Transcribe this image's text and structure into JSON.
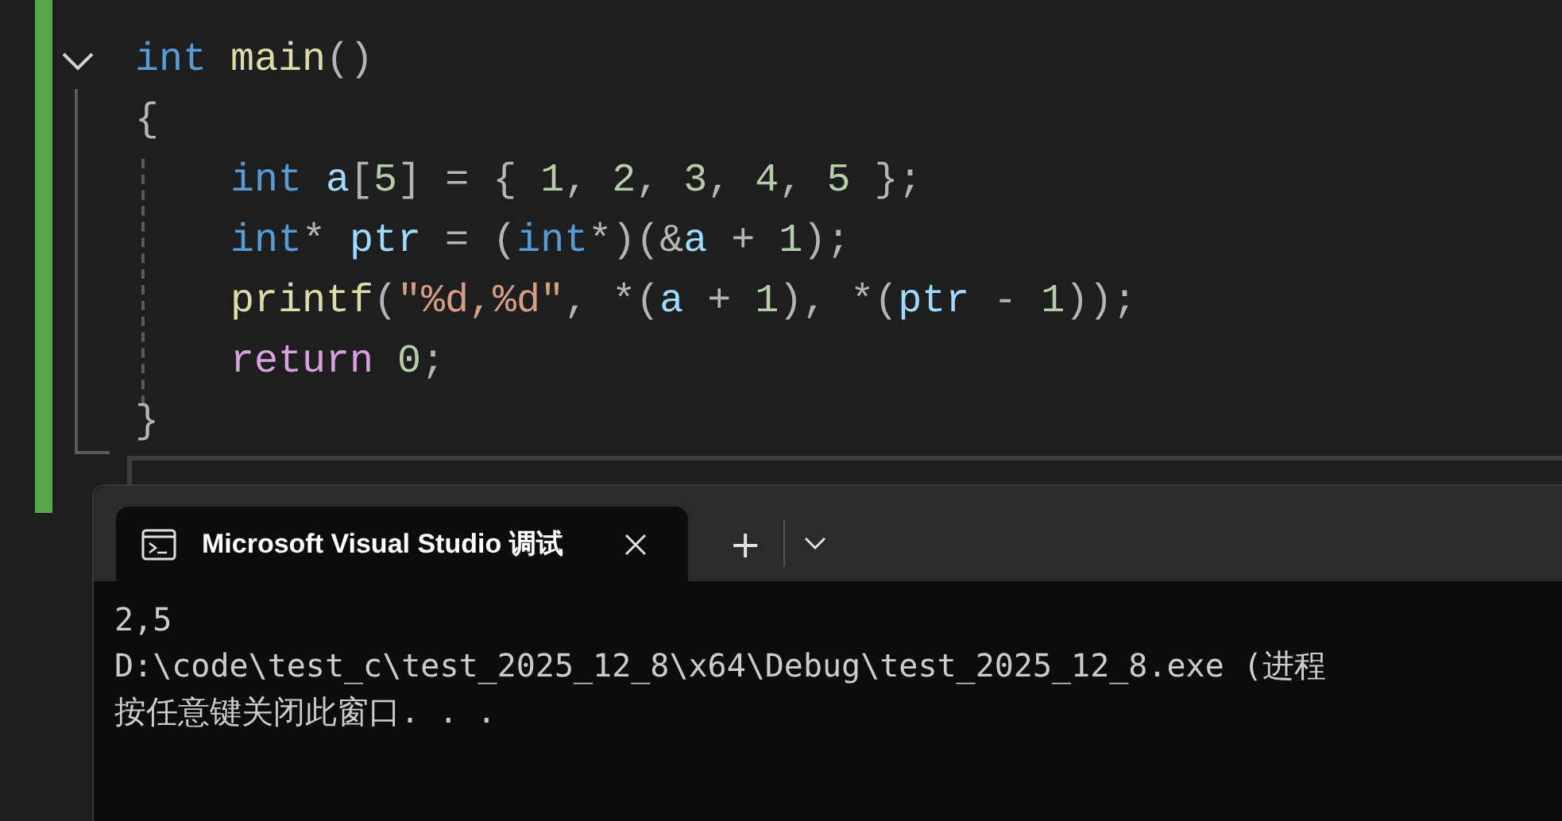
{
  "editor": {
    "function": {
      "signature": [
        {
          "kind": "keyword",
          "text": "int"
        },
        {
          "kind": "func",
          "text": "main"
        },
        {
          "kind": "punc",
          "text": "()"
        }
      ],
      "open_brace": "{",
      "body": [
        [
          {
            "kind": "keyword",
            "text": "int"
          },
          {
            "kind": "var",
            "text": "a"
          },
          {
            "kind": "punc",
            "text": "["
          },
          {
            "kind": "num",
            "text": "5"
          },
          {
            "kind": "punc",
            "text": "] = { "
          },
          {
            "kind": "num",
            "text": "1"
          },
          {
            "kind": "punc",
            "text": ", "
          },
          {
            "kind": "num",
            "text": "2"
          },
          {
            "kind": "punc",
            "text": ", "
          },
          {
            "kind": "num",
            "text": "3"
          },
          {
            "kind": "punc",
            "text": ", "
          },
          {
            "kind": "num",
            "text": "4"
          },
          {
            "kind": "punc",
            "text": ", "
          },
          {
            "kind": "num",
            "text": "5"
          },
          {
            "kind": "punc",
            "text": " };"
          }
        ],
        [
          {
            "kind": "keyword",
            "text": "int"
          },
          {
            "kind": "punc",
            "text": "* "
          },
          {
            "kind": "var",
            "text": "ptr"
          },
          {
            "kind": "punc",
            "text": " = ("
          },
          {
            "kind": "keyword",
            "text": "int"
          },
          {
            "kind": "punc",
            "text": "*)(&"
          },
          {
            "kind": "var",
            "text": "a"
          },
          {
            "kind": "punc",
            "text": " + "
          },
          {
            "kind": "num",
            "text": "1"
          },
          {
            "kind": "punc",
            "text": ");"
          }
        ],
        [
          {
            "kind": "func",
            "text": "printf"
          },
          {
            "kind": "punc",
            "text": "("
          },
          {
            "kind": "str",
            "text": "\"%d,%d\""
          },
          {
            "kind": "punc",
            "text": ", *("
          },
          {
            "kind": "var",
            "text": "a"
          },
          {
            "kind": "punc",
            "text": " + "
          },
          {
            "kind": "num",
            "text": "1"
          },
          {
            "kind": "punc",
            "text": "), *("
          },
          {
            "kind": "var",
            "text": "ptr"
          },
          {
            "kind": "punc",
            "text": " - "
          },
          {
            "kind": "num",
            "text": "1"
          },
          {
            "kind": "punc",
            "text": "));"
          }
        ],
        [
          {
            "kind": "control",
            "text": "return"
          },
          {
            "kind": "num",
            "text": "0"
          },
          {
            "kind": "punc",
            "text": ";"
          }
        ]
      ],
      "close_brace": "}"
    }
  },
  "terminal": {
    "tabs": [
      {
        "title": "Microsoft Visual Studio 调试",
        "selected": true
      }
    ],
    "new_tab": "+",
    "output": [
      "2,5",
      "D:\\code\\test_c\\test_2025_12_8\\x64\\Debug\\test_2025_12_8.exe (进程",
      "按任意键关闭此窗口. . ."
    ]
  }
}
